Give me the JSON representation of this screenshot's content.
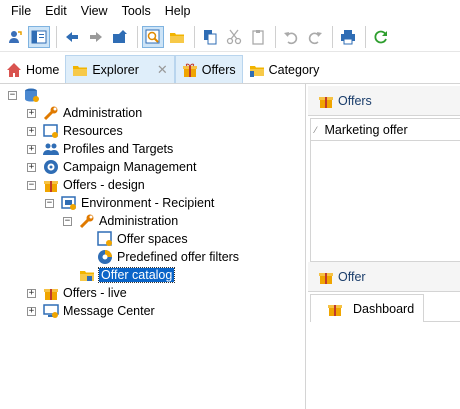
{
  "menu": [
    "File",
    "Edit",
    "View",
    "Tools",
    "Help"
  ],
  "tabs": [
    {
      "label": "Home",
      "icon": "home-icon"
    },
    {
      "label": "Explorer",
      "icon": "folder-icon",
      "close": "✕"
    },
    {
      "label": "Offers",
      "icon": "gift-icon"
    },
    {
      "label": "Category",
      "icon": "folder-category-icon"
    }
  ],
  "tree": {
    "items": [
      {
        "label": "Administration"
      },
      {
        "label": "Resources"
      },
      {
        "label": "Profiles and Targets"
      },
      {
        "label": "Campaign Management"
      },
      {
        "label": "Offers - design"
      },
      {
        "label": "Environment - Recipient"
      },
      {
        "label": "Administration"
      },
      {
        "label": "Offer spaces"
      },
      {
        "label": "Predefined offer filters"
      },
      {
        "label": "Offer catalog"
      },
      {
        "label": "Offers - live"
      },
      {
        "label": "Message Center"
      }
    ]
  },
  "right_panel": {
    "title": "Offers",
    "column_header": "Marketing offer",
    "detail_title": "Offer",
    "detail_tab": "Dashboard"
  },
  "colors": {
    "selection": "#0a64c8",
    "accent_gift": "#f0a500"
  }
}
